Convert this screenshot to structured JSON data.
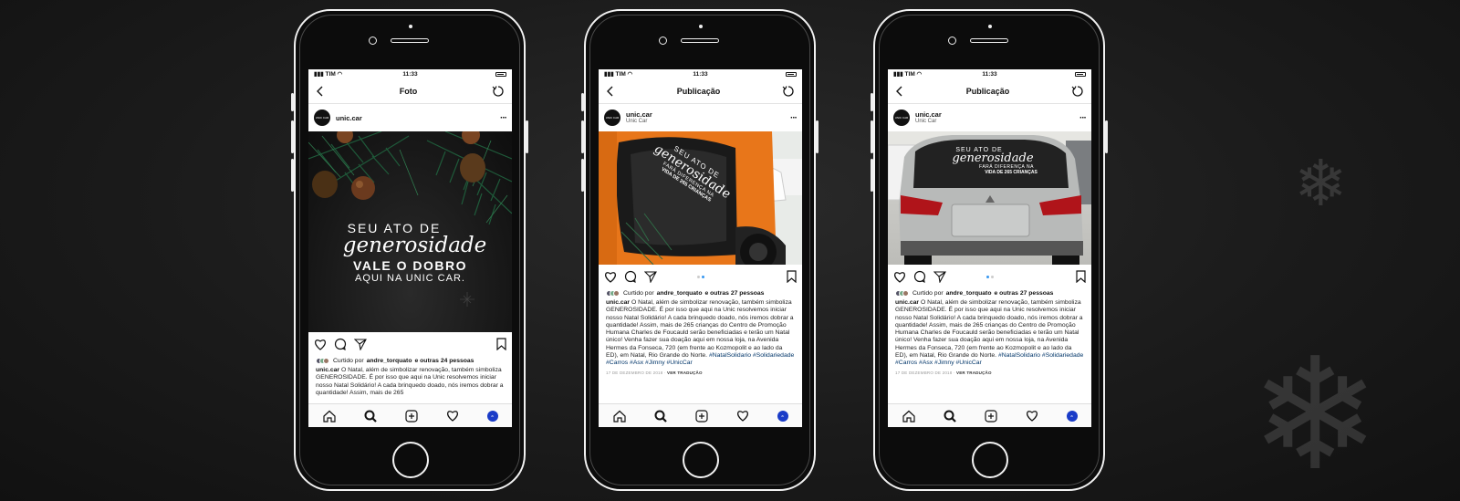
{
  "status": {
    "carrier": "TIM",
    "time": "11:33"
  },
  "phones": [
    {
      "nav_title": "Foto",
      "username": "unic.car",
      "location": "",
      "avatar_text": "UNIC CAR",
      "post_text": {
        "line1": "SEU ATO DE",
        "line2": "generosidade",
        "line3": "VALE O DOBRO",
        "line4": "AQUI NA UNIC CAR."
      },
      "liked_prefix": "Curtido por",
      "liked_user": "andre_torquato",
      "liked_suffix": "e outras 24 pessoas",
      "caption_user": "unic.car",
      "caption_text": "O Natal, além de simbolizar renovação, também simboliza GENEROSIDADE. É por isso que aqui na Unic resolvemos iniciar nosso Natal Solidário! A cada brinquedo doado, nós iremos dobrar a quantidade! Assim, mais de 265",
      "tags": "",
      "date": "",
      "translate": ""
    },
    {
      "nav_title": "Publicação",
      "username": "unic.car",
      "location": "Unic Car",
      "avatar_text": "UNIC CAR",
      "window_text": {
        "line1": "SEU ATO DE",
        "line2": "generosidade",
        "line3": "FARÁ DIFERENÇA NA",
        "line4": "VIDA DE 265 CRIANÇAS"
      },
      "liked_prefix": "Curtido por",
      "liked_user": "andre_torquato",
      "liked_suffix": "e outras 27 pessoas",
      "caption_user": "unic.car",
      "caption_text": "O Natal, além de simbolizar renovação, também simboliza GENEROSIDADE. É por isso que aqui na Unic resolvemos iniciar nosso Natal Solidário! A cada brinquedo doado, nós iremos dobrar a quantidade! Assim, mais de 265 crianças do Centro de Promoção Humana Charles de Foucauld serão beneficiadas e terão um Natal único! Venha fazer sua doação aqui em nossa loja, na Avenida Hermes da Fonseca, 720 (em frente ao Kozmopolit e ao lado da ED), em Natal, Rio Grande do Norte.",
      "tags": "#NatalSolidario #Solidariedade #Carros #Asx #Jimny #UnicCar",
      "date": "17 DE DEZEMBRO DE 2018",
      "translate": "VER TRADUÇÃO"
    },
    {
      "nav_title": "Publicação",
      "username": "unic.car",
      "location": "Unic Car",
      "avatar_text": "UNIC CAR",
      "window_text": {
        "line1": "SEU ATO DE",
        "line2": "generosidade",
        "line3": "FARÁ DIFERENÇA NA",
        "line4": "VIDA DE 265 CRIANÇAS"
      },
      "liked_prefix": "Curtido por",
      "liked_user": "andre_torquato",
      "liked_suffix": "e outras 27 pessoas",
      "caption_user": "unic.car",
      "caption_text": "O Natal, além de simbolizar renovação, também simboliza GENEROSIDADE. É por isso que aqui na Unic resolvemos iniciar nosso Natal Solidário! A cada brinquedo doado, nós iremos dobrar a quantidade! Assim, mais de 265 crianças do Centro de Promoção Humana Charles de Foucauld serão beneficiadas e terão um Natal único! Venha fazer sua doação aqui em nossa loja, na Avenida Hermes da Fonseca, 720 (em frente ao Kozmopolit e ao lado da ED), em Natal, Rio Grande do Norte.",
      "tags": "#NatalSolidario #Solidariedade #Carros #Asx #Jimny #UnicCar",
      "date": "17 DE DEZEMBRO DE 2018",
      "translate": "VER TRADUÇÃO"
    }
  ],
  "colors": {
    "tag_blue": "#003569",
    "carousel_active": "#3897f0",
    "profile_blue": "#1a3cc8",
    "car_orange": "#e8761a"
  },
  "icons": [
    "back-icon",
    "refresh-icon",
    "more-icon",
    "heart-icon",
    "comment-icon",
    "share-icon",
    "bookmark-icon",
    "home-icon",
    "search-icon",
    "add-icon",
    "activity-icon",
    "profile-icon",
    "snowflake-icon"
  ]
}
